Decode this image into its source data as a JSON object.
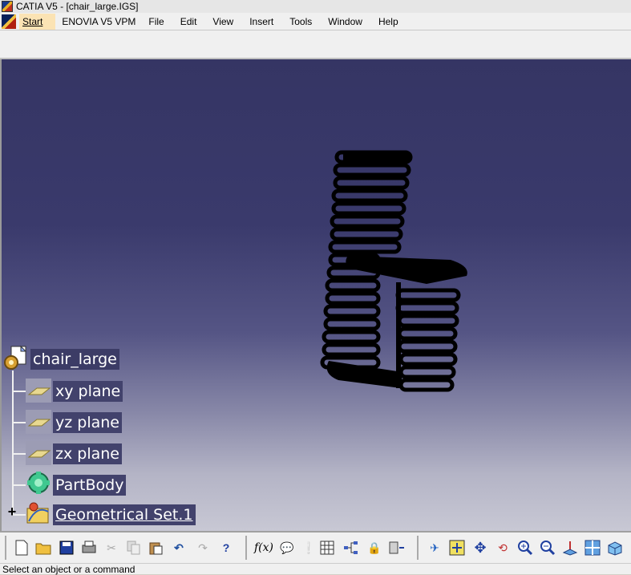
{
  "window": {
    "title": "CATIA V5 - [chair_large.IGS]"
  },
  "menu": {
    "start": "Start",
    "items": [
      "ENOVIA V5 VPM",
      "File",
      "Edit",
      "View",
      "Insert",
      "Tools",
      "Window",
      "Help"
    ]
  },
  "tree": {
    "root": "chair_large",
    "nodes": [
      {
        "label": "xy plane",
        "icon": "plane-icon"
      },
      {
        "label": "yz plane",
        "icon": "plane-icon"
      },
      {
        "label": "zx plane",
        "icon": "plane-icon"
      },
      {
        "label": "PartBody",
        "icon": "partbody-icon"
      },
      {
        "label": "Geometrical Set.1",
        "icon": "geometrical-set-icon"
      }
    ]
  },
  "toolbar": {
    "icons": [
      "new-icon",
      "open-icon",
      "save-icon",
      "print-icon",
      "cut-icon",
      "copy-icon",
      "paste-icon",
      "undo-icon",
      "redo-icon",
      "whats-this-icon",
      "formula-icon",
      "comment-icon",
      "light-icon",
      "table-icon",
      "tree-icon",
      "lock-icon",
      "knowledge-icon",
      "fly-icon",
      "fit-all-icon",
      "pan-icon",
      "rotate-icon",
      "zoom-in-icon",
      "zoom-out-icon",
      "normal-view-icon",
      "multi-view-icon",
      "iso-view-icon"
    ]
  },
  "status": {
    "text": "Select an object or a command"
  },
  "colors": {
    "viewport_top": "#353564",
    "viewport_bottom": "#c8c8d4",
    "node_label_bg": "#42426c",
    "start_highlight": "#fbe3b4"
  }
}
